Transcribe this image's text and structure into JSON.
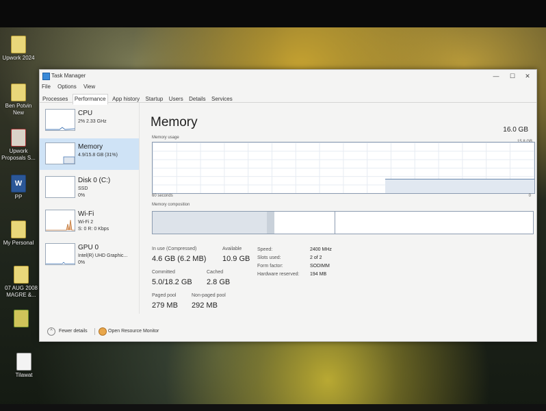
{
  "desktop": {
    "icons": [
      {
        "label": "Upwork 2024"
      },
      {
        "label": "Ben Potvin New"
      },
      {
        "label": "Upwork Proposals S..."
      },
      {
        "label": "PP"
      },
      {
        "label": "My Personal"
      },
      {
        "label": "07 AUG 2008 MAGRE &..."
      },
      {
        "label": ""
      },
      {
        "label": "Tilawat"
      }
    ]
  },
  "window": {
    "title": "Task Manager",
    "controls": {
      "minimize": "—",
      "maximize": "☐",
      "close": "✕"
    },
    "menu": [
      "File",
      "Options",
      "View"
    ],
    "tabs": [
      "Processes",
      "Performance",
      "App history",
      "Startup",
      "Users",
      "Details",
      "Services"
    ],
    "active_tab": "Performance"
  },
  "sidebar": {
    "items": [
      {
        "name": "CPU",
        "sub1": "2% 2.33 GHz",
        "sub2": ""
      },
      {
        "name": "Memory",
        "sub1": "4.9/15.8 GB (31%)",
        "sub2": ""
      },
      {
        "name": "Disk 0 (C:)",
        "sub1": "SSD",
        "sub2": "0%"
      },
      {
        "name": "Wi-Fi",
        "sub1": "Wi-Fi 2",
        "sub2": "S: 0 R: 0 Kbps"
      },
      {
        "name": "GPU 0",
        "sub1": "Intel(R) UHD Graphic...",
        "sub2": "0%"
      }
    ],
    "selected": "Memory"
  },
  "memory": {
    "title": "Memory",
    "total": "16.0 GB",
    "usage_label": "Memory usage",
    "usage_max": "15.8 GB",
    "time_label": "60 seconds",
    "time_end": "0",
    "composition_label": "Memory composition",
    "stats": {
      "in_use_label": "In use (Compressed)",
      "in_use_value": "4.6 GB (6.2 MB)",
      "available_label": "Available",
      "available_value": "10.9 GB",
      "committed_label": "Committed",
      "committed_value": "5.0/18.2 GB",
      "cached_label": "Cached",
      "cached_value": "2.8 GB",
      "paged_label": "Paged pool",
      "paged_value": "279 MB",
      "nonpaged_label": "Non-paged pool",
      "nonpaged_value": "292 MB"
    },
    "details": [
      {
        "k": "Speed:",
        "v": "2400 MHz"
      },
      {
        "k": "Slots used:",
        "v": "2 of 2"
      },
      {
        "k": "Form factor:",
        "v": "SODIMM"
      },
      {
        "k": "Hardware reserved:",
        "v": "194 MB"
      }
    ]
  },
  "footer": {
    "fewer_details": "Fewer details",
    "open_resource_monitor": "Open Resource Monitor"
  }
}
